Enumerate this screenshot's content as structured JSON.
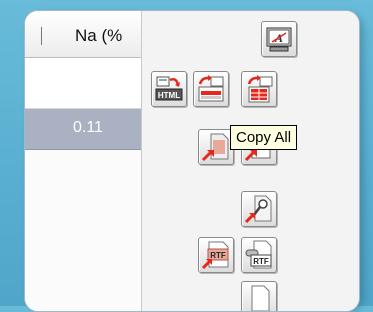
{
  "grid": {
    "column_header": "Na (%",
    "selected_value": "0.11"
  },
  "toolbar": {
    "buttons": [
      {
        "name": "html-export-button",
        "icon": "html-export-icon",
        "badge": "HTML"
      },
      {
        "name": "copy-selection-button",
        "icon": "copy-selection-icon"
      },
      {
        "name": "copy-all-button",
        "icon": "copy-all-icon"
      },
      {
        "name": "screen-font-button",
        "icon": "screen-font-icon",
        "badge": "A"
      },
      {
        "name": "export-document-button",
        "icon": "document-export-icon"
      },
      {
        "name": "export-grid-button",
        "icon": "grid-export-icon"
      },
      {
        "name": "tool-export-button",
        "icon": "tool-export-icon"
      },
      {
        "name": "rtf-export-button",
        "icon": "rtf-export-icon",
        "badge": "RTF"
      },
      {
        "name": "rtf-copy-button",
        "icon": "rtf-copy-icon",
        "badge": "RTF"
      },
      {
        "name": "document-button",
        "icon": "document-icon"
      }
    ]
  },
  "tooltip": {
    "text": "Copy All"
  },
  "colors": {
    "background": "#5fb3d3",
    "selected_row": "#a9b1c2",
    "tooltip_bg": "#ffffe1",
    "arrow_red": "#e8261c"
  }
}
